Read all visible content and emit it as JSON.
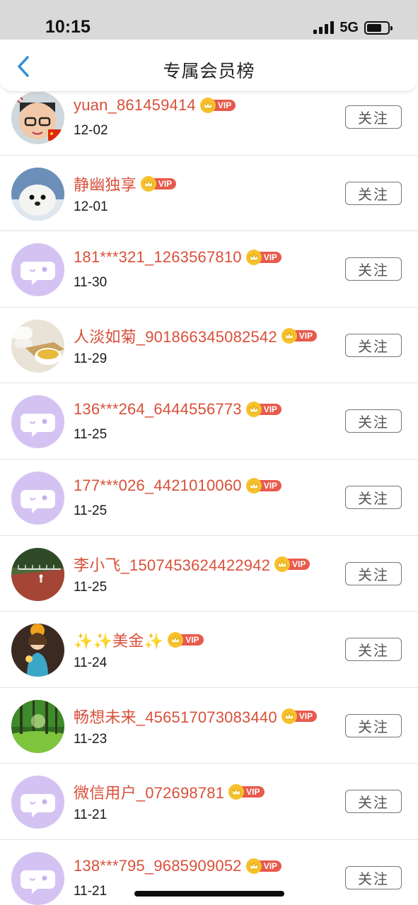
{
  "status_bar": {
    "time": "10:15",
    "network": "5G"
  },
  "header": {
    "title": "专属会员榜",
    "back_icon": "chevron-left-icon"
  },
  "vip_badge_text": "VIP",
  "follow_label": "关注",
  "colors": {
    "name": "#d9503a",
    "vip_tag": "#e85a4c",
    "crown": "#f7c12c",
    "default_avatar": "#d4c3f2"
  },
  "members": [
    {
      "name": "yuan_861459414",
      "date": "12-02",
      "avatar": "photo-face"
    },
    {
      "name": "静幽独享",
      "date": "12-01",
      "avatar": "photo-seal"
    },
    {
      "name": "181***321_1263567810",
      "date": "11-30",
      "avatar": "default"
    },
    {
      "name": "人淡如菊_901866345082542",
      "date": "11-29",
      "avatar": "photo-tea"
    },
    {
      "name": "136***264_6444556773",
      "date": "11-25",
      "avatar": "default"
    },
    {
      "name": "177***026_4421010060",
      "date": "11-25",
      "avatar": "default"
    },
    {
      "name": "李小飞_1507453624422942",
      "date": "11-25",
      "avatar": "photo-track"
    },
    {
      "name": "✨✨美金✨",
      "date": "11-24",
      "avatar": "photo-girl"
    },
    {
      "name": "畅想未来_456517073083440",
      "date": "11-23",
      "avatar": "photo-forest"
    },
    {
      "name": "微信用户_072698781",
      "date": "11-21",
      "avatar": "default"
    },
    {
      "name": "138***795_9685909052",
      "date": "11-21",
      "avatar": "default"
    }
  ]
}
